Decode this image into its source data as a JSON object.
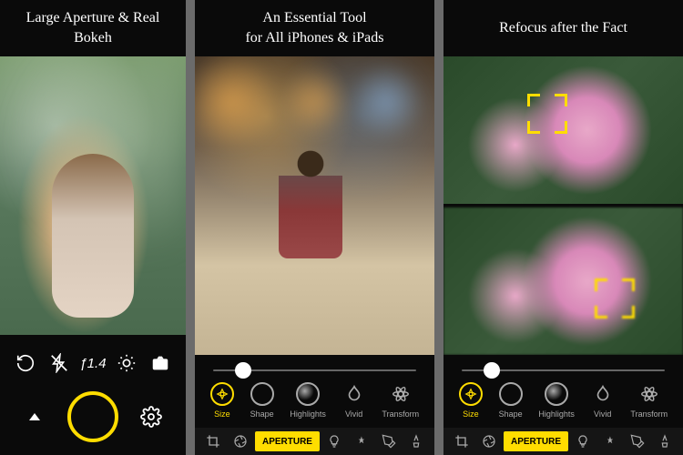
{
  "panels": [
    {
      "title": "Large Aperture & Real Bokeh"
    },
    {
      "title": "An Essential Tool\nfor All iPhones & iPads"
    },
    {
      "title": "Refocus after the Fact"
    }
  ],
  "camera_controls": {
    "aperture_value": "ƒ1.4"
  },
  "tools": [
    {
      "label": "Size",
      "active": true
    },
    {
      "label": "Shape",
      "active": false
    },
    {
      "label": "Highlights",
      "active": false
    },
    {
      "label": "Vivid",
      "active": false
    },
    {
      "label": "Transform",
      "active": false
    }
  ],
  "bottom_bar": {
    "active_label": "APERTURE"
  },
  "slider": {
    "position_pct": 15
  }
}
